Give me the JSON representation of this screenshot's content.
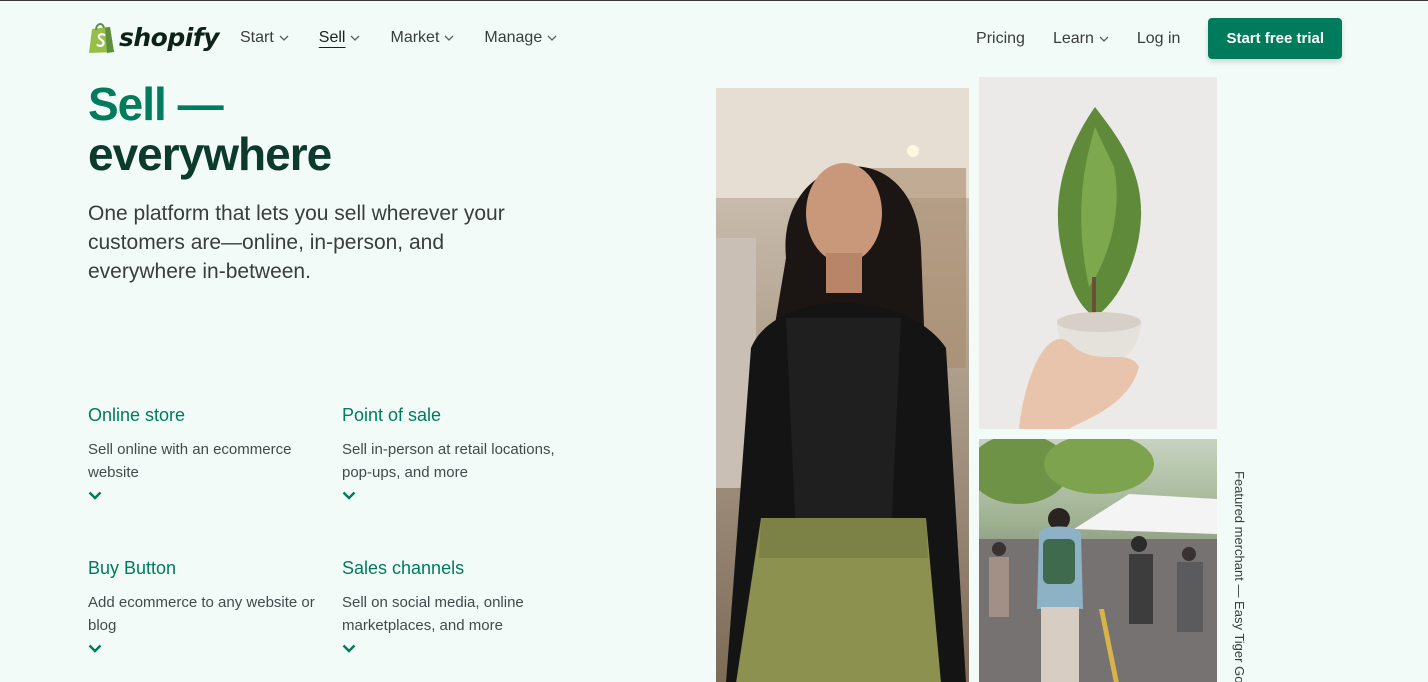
{
  "brand": {
    "name": "shopify",
    "accent": "#007b5c",
    "dark": "#0c3a2c"
  },
  "nav": {
    "left": [
      {
        "label": "Start",
        "dropdown": true,
        "active": false
      },
      {
        "label": "Sell",
        "dropdown": true,
        "active": true
      },
      {
        "label": "Market",
        "dropdown": true,
        "active": false
      },
      {
        "label": "Manage",
        "dropdown": true,
        "active": false
      }
    ],
    "pricing": "Pricing",
    "learn": "Learn",
    "login": "Log in",
    "cta": "Start free trial"
  },
  "hero": {
    "title_line1": "Sell —",
    "title_line2": "everywhere",
    "subtitle": "One platform that lets you sell wherever your customers are—online, in-person, and everywhere in-between."
  },
  "features": [
    {
      "title": "Online store",
      "desc": "Sell online with an ecommerce website",
      "icon": "chevron-down-icon"
    },
    {
      "title": "Point of sale",
      "desc": "Sell in-person at retail locations, pop-ups, and more",
      "icon": "chevron-down-icon"
    },
    {
      "title": "Buy Button",
      "desc": "Add ecommerce to any website or blog",
      "icon": "chevron-down-icon"
    },
    {
      "title": "Sales channels",
      "desc": "Sell on social media, online marketplaces, and more",
      "icon": "chevron-down-icon"
    }
  ],
  "caption": "Featured merchant — Easy Tiger Go"
}
